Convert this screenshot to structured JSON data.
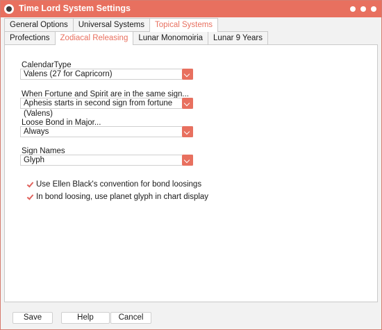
{
  "window": {
    "title": "Time Lord System Settings",
    "accent": "#e8705f"
  },
  "top_tabs": [
    "General Options",
    "Universal Systems",
    "Topical Systems"
  ],
  "top_tabs_active": "Topical Systems",
  "sub_tabs": [
    "Profections",
    "Zodiacal Releasing",
    "Lunar Monomoiria",
    "Lunar 9 Years"
  ],
  "sub_tabs_active": "Zodiacal Releasing",
  "fields": [
    {
      "label": "CalendarType",
      "value": "Valens (27 for Capricorn)"
    },
    {
      "label": "When Fortune and Spirit are in the same sign...",
      "value": "Aphesis starts in second sign from fortune (Valens)"
    },
    {
      "label": "Loose Bond in Major...",
      "value": "Always"
    },
    {
      "label": "Sign Names",
      "value": "Glyph"
    }
  ],
  "checkboxes": [
    {
      "label": "Use Ellen Black's convention for bond loosings",
      "checked": true
    },
    {
      "label": "In bond loosing, use planet glyph in chart display",
      "checked": true
    }
  ],
  "buttons": {
    "save": "Save",
    "help": "Help",
    "cancel": "Cancel"
  }
}
